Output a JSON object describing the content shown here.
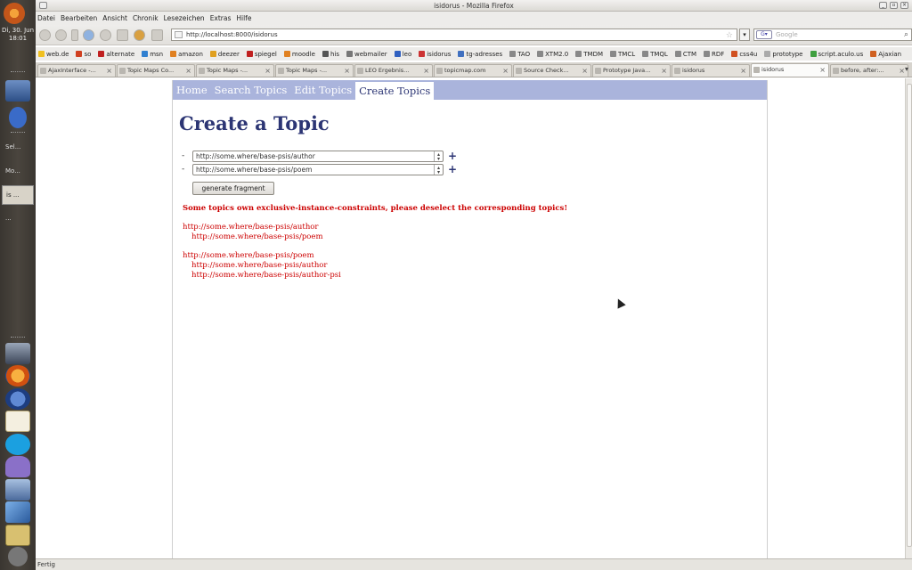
{
  "window": {
    "title": "isidorus - Mozilla Firefox"
  },
  "menu": [
    "Datei",
    "Bearbeiten",
    "Ansicht",
    "Chronik",
    "Lesezeichen",
    "Extras",
    "Hilfe"
  ],
  "clock": {
    "line1": "Di, 30. Jun",
    "line2": "18:01"
  },
  "dock_tasks": [
    "Sel...",
    "Mo...",
    "is ...",
    "..."
  ],
  "address": {
    "url": "http://localhost:8000/isidorus"
  },
  "search": {
    "placeholder": "Google"
  },
  "bookmarks": [
    {
      "label": "web.de",
      "color": "#f0c020"
    },
    {
      "label": "so",
      "color": "#d04020"
    },
    {
      "label": "alternate",
      "color": "#c02020"
    },
    {
      "label": "msn",
      "color": "#3080d0"
    },
    {
      "label": "amazon",
      "color": "#e08020"
    },
    {
      "label": "deezer",
      "color": "#e0a020"
    },
    {
      "label": "spiegel",
      "color": "#c02020"
    },
    {
      "label": "moodle",
      "color": "#e08020"
    },
    {
      "label": "his",
      "color": "#555555"
    },
    {
      "label": "webmailer",
      "color": "#777777"
    },
    {
      "label": "leo",
      "color": "#3060c0"
    },
    {
      "label": "isidorus",
      "color": "#cc3333"
    },
    {
      "label": "tg-adresses",
      "color": "#4070c0"
    },
    {
      "label": "TAO",
      "color": "#888888"
    },
    {
      "label": "XTM2.0",
      "color": "#888888"
    },
    {
      "label": "TMDM",
      "color": "#888888"
    },
    {
      "label": "TMCL",
      "color": "#888888"
    },
    {
      "label": "TMQL",
      "color": "#888888"
    },
    {
      "label": "CTM",
      "color": "#888888"
    },
    {
      "label": "RDF",
      "color": "#888888"
    },
    {
      "label": "css4u",
      "color": "#d05020"
    },
    {
      "label": "prototype",
      "color": "#aaaaaa"
    },
    {
      "label": "script.aculo.us",
      "color": "#40a040"
    },
    {
      "label": "Ajaxian",
      "color": "#d06020"
    }
  ],
  "tabs": [
    {
      "label": "AjaxInterface -..."
    },
    {
      "label": "Topic Maps Co..."
    },
    {
      "label": "Topic Maps -..."
    },
    {
      "label": "Topic Maps -..."
    },
    {
      "label": "LEO Ergebnis..."
    },
    {
      "label": "topicmap.com"
    },
    {
      "label": "Source Check..."
    },
    {
      "label": "Prototype Java..."
    },
    {
      "label": "isidorus"
    },
    {
      "label": "isidorus",
      "active": true
    },
    {
      "label": "before, after:..."
    }
  ],
  "site": {
    "nav": [
      "Home",
      "Search Topics",
      "Edit Topics",
      "Create Topics"
    ],
    "title": "Create a Topic",
    "selects": [
      {
        "dash": "-",
        "value": "http://some.where/base-psis/author"
      },
      {
        "dash": "-",
        "value": "http://some.where/base-psis/poem"
      }
    ],
    "plus": "+",
    "generate_button": "generate fragment",
    "error_main": "Some topics own exclusive-instance-constraints, please deselect the corresponding topics!",
    "error_groups": [
      {
        "topic": "http://some.where/base-psis/author",
        "items": [
          "http://some.where/base-psis/poem"
        ]
      },
      {
        "topic": "http://some.where/base-psis/poem",
        "items": [
          "http://some.where/base-psis/author",
          "http://some.where/base-psis/author-psi"
        ]
      }
    ]
  },
  "status": {
    "text": "Fertig"
  }
}
